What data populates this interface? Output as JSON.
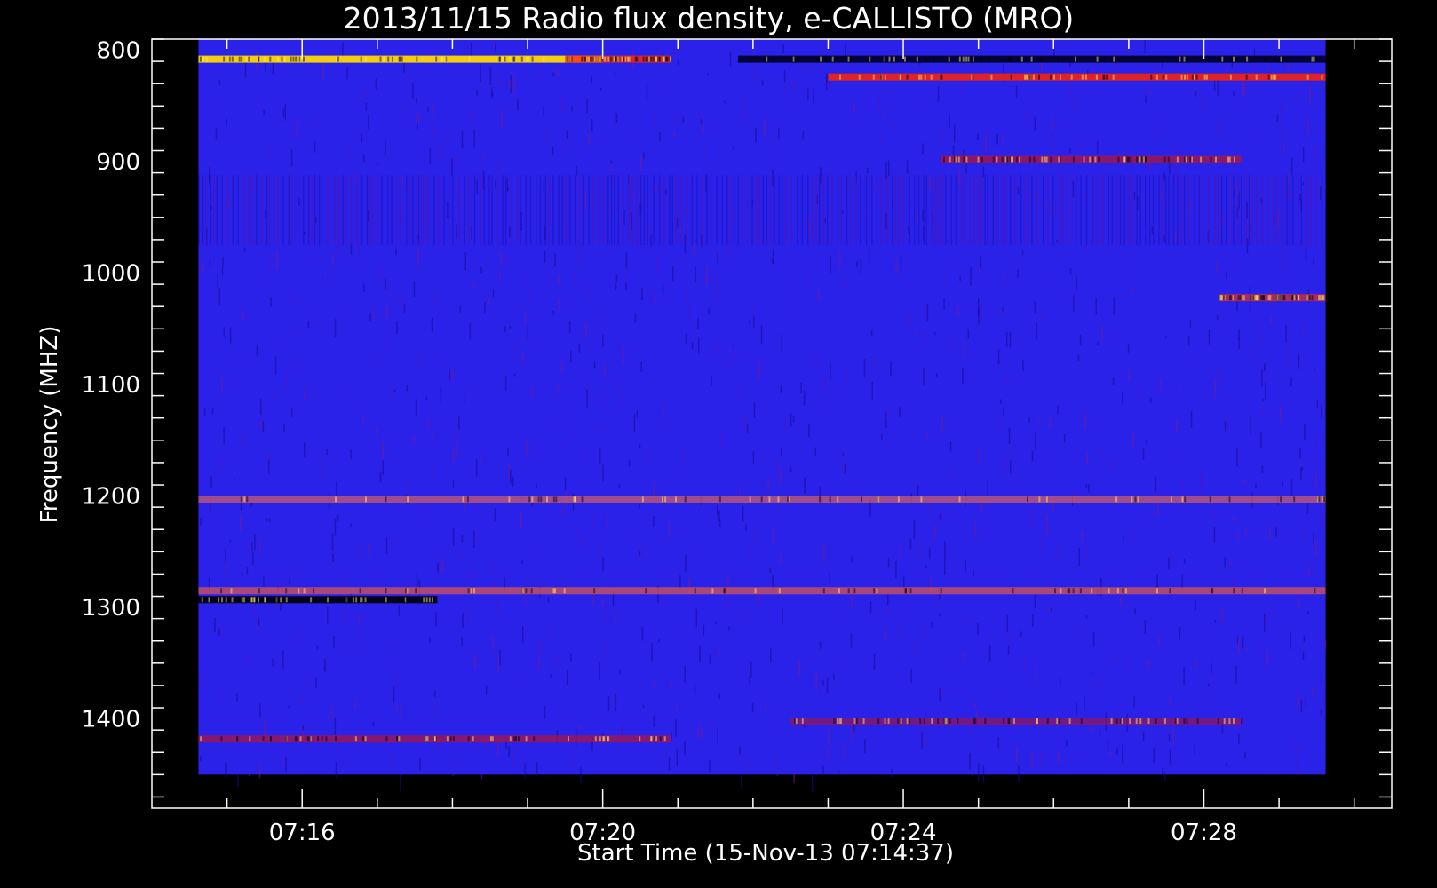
{
  "chart_data": {
    "type": "heatmap",
    "title": "2013/11/15  Radio flux density, e-CALLISTO (MRO)",
    "xlabel": "Start Time (15-Nov-13 07:14:37)",
    "ylabel": "Frequency (MHZ)",
    "x_ticks": [
      {
        "label": "07:16",
        "minute": 16
      },
      {
        "label": "07:20",
        "minute": 20
      },
      {
        "label": "07:24",
        "minute": 24
      },
      {
        "label": "07:28",
        "minute": 28
      }
    ],
    "y_ticks": [
      {
        "label": "800",
        "value": 800
      },
      {
        "label": "900",
        "value": 900
      },
      {
        "label": "1000",
        "value": 1000
      },
      {
        "label": "1100",
        "value": 1100
      },
      {
        "label": "1200",
        "value": 1200
      },
      {
        "label": "1300",
        "value": 1300
      },
      {
        "label": "1400",
        "value": 1400
      }
    ],
    "xlim_minutes": [
      14.0,
      30.5
    ],
    "data_xlim_minutes": [
      14.62,
      29.62
    ],
    "ylim": [
      790,
      1480
    ],
    "data_ylim": [
      790,
      1450
    ],
    "y_inverted": true,
    "colormap": [
      "#000000",
      "#0000ff",
      "#ff0000",
      "#ffff00"
    ],
    "background_color": "#2a22e8",
    "bands": [
      {
        "freq": 808,
        "t_start": 14.62,
        "t_end": 20.0,
        "color": "#ffd800",
        "intensity": 0.95
      },
      {
        "freq": 808,
        "t_start": 19.5,
        "t_end": 20.9,
        "color": "#ff2a00",
        "intensity": 0.8
      },
      {
        "freq": 808,
        "t_start": 21.8,
        "t_end": 29.62,
        "color": "#000022",
        "intensity": 0.9
      },
      {
        "freq": 824,
        "t_start": 23.0,
        "t_end": 29.62,
        "color": "#ff2200",
        "intensity": 0.85
      },
      {
        "freq": 898,
        "t_start": 24.5,
        "t_end": 28.5,
        "color": "#cc1010",
        "intensity": 0.6
      },
      {
        "freq": 1022,
        "t_start": 28.2,
        "t_end": 29.62,
        "color": "#ff3000",
        "intensity": 0.6
      },
      {
        "freq": 1203,
        "t_start": 14.62,
        "t_end": 29.62,
        "color": "#ff7040",
        "intensity": 0.55
      },
      {
        "freq": 1285,
        "t_start": 14.62,
        "t_end": 29.62,
        "color": "#ff6030",
        "intensity": 0.6
      },
      {
        "freq": 1293,
        "t_start": 14.62,
        "t_end": 17.8,
        "color": "#000010",
        "intensity": 0.95
      },
      {
        "freq": 1402,
        "t_start": 22.5,
        "t_end": 28.5,
        "color": "#b01030",
        "intensity": 0.55
      },
      {
        "freq": 1418,
        "t_start": 14.62,
        "t_end": 20.9,
        "color": "#c81020",
        "intensity": 0.6
      }
    ]
  }
}
